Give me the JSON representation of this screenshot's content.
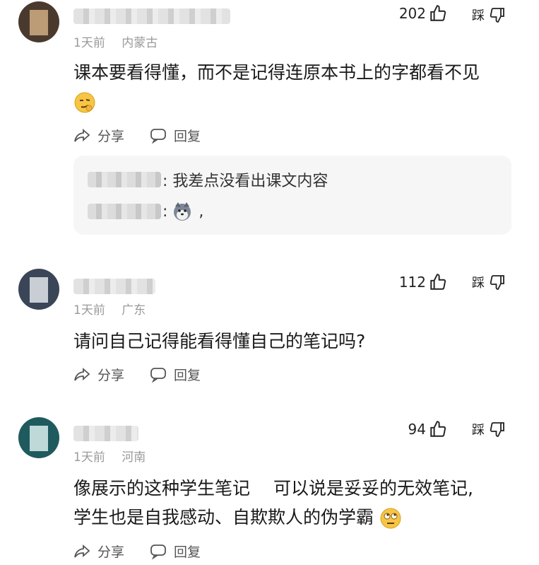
{
  "comments": [
    {
      "likes": "202",
      "dislike_label": "踩",
      "time": "1天前",
      "location": "内蒙古",
      "text": "课本要看得懂，而不是记得连原本书上的字都看不见",
      "share_label": "分享",
      "reply_label": "回复",
      "replies": [
        {
          "text": ": 我差点没看出课文内容"
        },
        {
          "text": ","
        }
      ]
    },
    {
      "likes": "112",
      "dislike_label": "踩",
      "time": "1天前",
      "location": "广东",
      "text": "请问自己记得能看得懂自己的笔记吗?",
      "share_label": "分享",
      "reply_label": "回复"
    },
    {
      "likes": "94",
      "dislike_label": "踩",
      "time": "1天前",
      "location": "河南",
      "text_line1": "像展示的这种学生笔记　 可以说是妥妥的无效笔记,",
      "text_line2": "学生也是自我感动、自欺欺人的伪学霸",
      "share_label": "分享",
      "reply_label": "回复"
    }
  ],
  "icons": [
    "thumb-up-icon",
    "thumb-down-icon",
    "share-icon",
    "reply-icon",
    "smirk-emoji-icon",
    "husky-emoji-icon",
    "rolling-eyes-emoji-icon"
  ]
}
